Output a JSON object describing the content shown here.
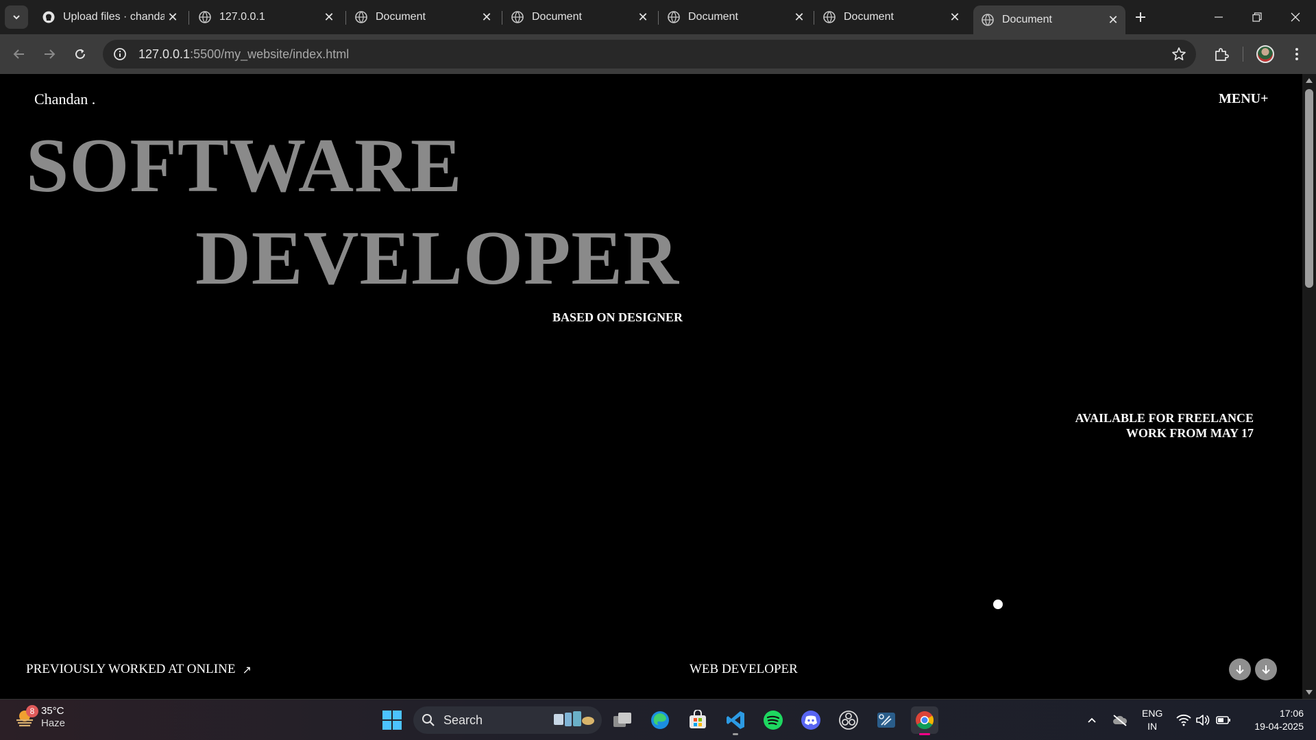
{
  "browser": {
    "tabs": [
      {
        "title": "Upload files · chanda",
        "favicon": "github-icon",
        "active": false
      },
      {
        "title": "127.0.0.1",
        "favicon": "globe-icon",
        "active": false
      },
      {
        "title": "Document",
        "favicon": "globe-icon",
        "active": false
      },
      {
        "title": "Document",
        "favicon": "globe-icon",
        "active": false
      },
      {
        "title": "Document",
        "favicon": "globe-icon",
        "active": false
      },
      {
        "title": "Document",
        "favicon": "globe-icon",
        "active": false
      },
      {
        "title": "Document",
        "favicon": "globe-icon",
        "active": true
      }
    ],
    "address": {
      "host": "127.0.0.1",
      "path": ":5500/my_website/index.html"
    }
  },
  "page": {
    "brand": "Chandan .",
    "menu": "MENU+",
    "hero_line1": "SOFTWARE",
    "hero_line2": "DEVELOPER",
    "based": "BASED ON DESIGNER",
    "freelance_line1": "AVAILABLE FOR FREELANCE",
    "freelance_line2": "WORK FROM MAY 17",
    "previously": "PREVIOUSLY WORKED AT ONLINE",
    "role": "WEB DEVELOPER",
    "arrow_symbol": "↗"
  },
  "taskbar": {
    "weather": {
      "temp": "35°C",
      "condition": "Haze",
      "badge": "8"
    },
    "search_label": "Search",
    "lang_line1": "ENG",
    "lang_line2": "IN",
    "time": "17:06",
    "date": "19-04-2025"
  },
  "colors": {
    "hero_text": "#8a8a8a",
    "page_background": "#000000",
    "tab_strip": "#1f1f1f",
    "toolbar": "#3c3c3c"
  }
}
